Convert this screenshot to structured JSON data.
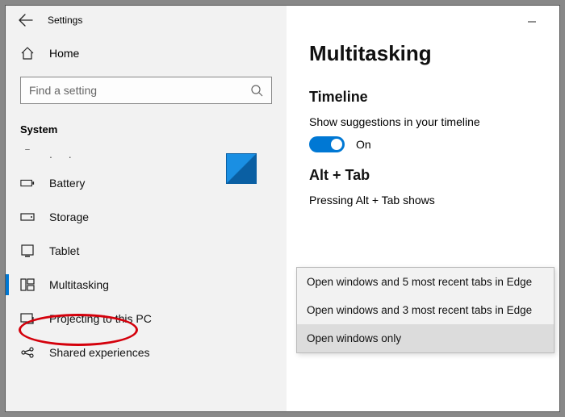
{
  "titlebar": {
    "title": "Settings"
  },
  "home_label": "Home",
  "search": {
    "placeholder": "Find a setting"
  },
  "section_header": "System",
  "nav": [
    {
      "label": "Battery",
      "icon": "battery"
    },
    {
      "label": "Storage",
      "icon": "storage"
    },
    {
      "label": "Tablet",
      "icon": "tablet"
    },
    {
      "label": "Multitasking",
      "icon": "multitask",
      "active": true
    },
    {
      "label": "Projecting to this PC",
      "icon": "project"
    },
    {
      "label": "Shared experiences",
      "icon": "shared"
    }
  ],
  "main": {
    "page_title": "Multitasking",
    "timeline": {
      "heading": "Timeline",
      "label": "Show suggestions in your timeline",
      "toggle_state": "On"
    },
    "alttab": {
      "heading": "Alt + Tab",
      "label": "Pressing Alt + Tab shows",
      "options": [
        "Open windows and 5 most recent tabs in Edge",
        "Open windows and 3 most recent tabs in Edge",
        "Open windows only"
      ],
      "selected_index": 2
    }
  }
}
